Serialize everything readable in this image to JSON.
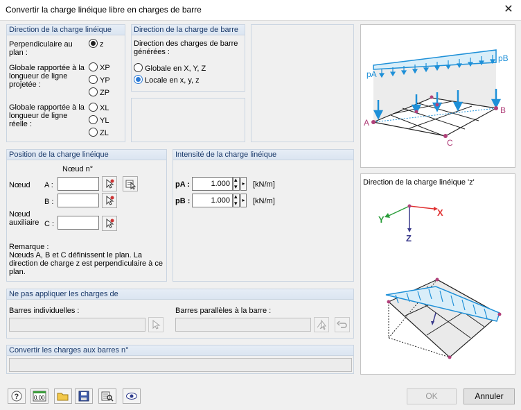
{
  "window": {
    "title": "Convertir la charge linéique libre en charges de barre",
    "close_glyph": "✕"
  },
  "direction_charge": {
    "header": "Direction de la charge linéique",
    "perp_label": "Perpendiculaire au plan :",
    "perp_option": "z",
    "proj_label": "Globale rapportée à la longueur de ligne projetée :",
    "proj_options": [
      "XP",
      "YP",
      "ZP"
    ],
    "real_label": "Globale rapportée à la longueur de ligne réelle :",
    "real_options": [
      "XL",
      "YL",
      "ZL"
    ],
    "selected": "z"
  },
  "direction_barre": {
    "header": "Direction de la charge de barre",
    "desc": "Direction des charges de barre générées :",
    "options": [
      "Globale en X, Y, Z",
      "Locale en x, y, z"
    ],
    "selected": "Locale en x, y, z"
  },
  "position": {
    "header": "Position de la charge linéique",
    "col_header": "Nœud n°",
    "noeud_label": "Nœud",
    "a_label": "A :",
    "b_label": "B :",
    "aux_label": "Nœud auxiliaire",
    "c_label": "C :",
    "a_value": "",
    "b_value": "",
    "c_value": "",
    "remarque_title": "Remarque :",
    "remarque_text": "Nœuds A, B et C définissent le plan. La direction de charge z est perpendiculaire à ce plan."
  },
  "intensite": {
    "header": "Intensité de la charge linéique",
    "pa_label": "pA :",
    "pb_label": "pB :",
    "pa_value": "1.000",
    "pb_value": "1.000",
    "unit": "[kN/m]"
  },
  "exclusion": {
    "header": "Ne pas appliquer les charges de",
    "individual_label": "Barres individuelles :",
    "parallel_label": "Barres parallèles à la barre :",
    "individual_value": "",
    "parallel_value": ""
  },
  "convert": {
    "header": "Convertir les charges aux barres n°",
    "value": ""
  },
  "preview_top": {
    "pa": "pA",
    "pb": "pB",
    "a": "A",
    "b": "B",
    "c": "C"
  },
  "preview_bottom": {
    "title": "Direction de la charge linéique 'z'",
    "x": "X",
    "y": "Y",
    "z": "Z"
  },
  "footer": {
    "ok": "OK",
    "cancel": "Annuler",
    "icons": [
      "help-icon",
      "units-icon",
      "open-folder-icon",
      "save-icon",
      "search-icon",
      "view-icon"
    ],
    "units_text": "0.00"
  },
  "colors": {
    "accent": "#2d7bd6",
    "load_blue": "#1e90d8",
    "node_magenta": "#b0407a",
    "axis_red": "#e03030",
    "axis_green": "#2a9d3a",
    "axis_blue": "#3a3a8c"
  }
}
